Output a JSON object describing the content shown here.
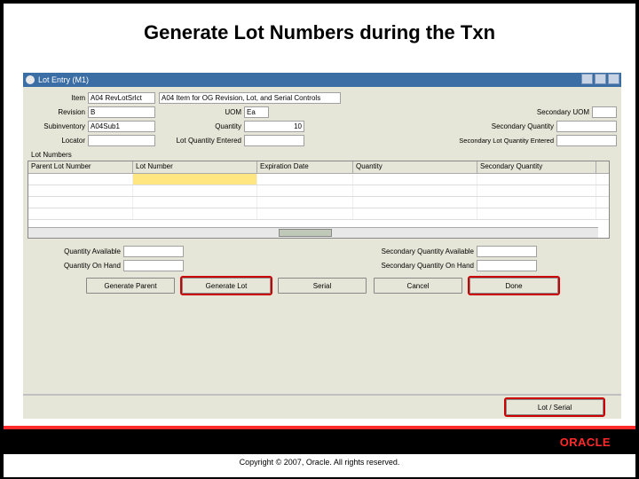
{
  "slide_title": "Generate Lot Numbers during the Txn",
  "window_title": "Lot Entry (M1)",
  "fields": {
    "item_label": "Item",
    "item_value": "A04 RevLotSrlct",
    "item_desc": "A04 Item for OG Revision, Lot, and Serial Controls",
    "revision_label": "Revision",
    "revision_value": "B",
    "uom_label": "UOM",
    "uom_value": "Ea",
    "sec_uom_label": "Secondary UOM",
    "sub_label": "Subinventory",
    "sub_value": "A04Sub1",
    "qty_label": "Quantity",
    "qty_value": "10",
    "sec_qty_label": "Secondary Quantity",
    "locator_label": "Locator",
    "lot_qty_entered_label": "Lot Quantity Entered",
    "sec_lot_qty_entered_label": "Secondary Lot Quantity Entered"
  },
  "section_lot_numbers": "Lot Numbers",
  "grid": {
    "headers": [
      "Parent Lot Number",
      "Lot Number",
      "Expiration Date",
      "Quantity",
      "Secondary Quantity"
    ]
  },
  "qty_block": {
    "qty_avail_label": "Quantity Available",
    "qty_onhand_label": "Quantity On Hand",
    "sec_qty_avail_label": "Secondary Quantity Available",
    "sec_qty_onhand_label": "Secondary Quantity On Hand"
  },
  "buttons": {
    "generate_parent": "Generate Parent",
    "generate_lot": "Generate Lot",
    "serial": "Serial",
    "cancel": "Cancel",
    "done": "Done",
    "lot_serial": "Lot / Serial"
  },
  "brand": {
    "oracle": "ORACLE"
  },
  "copyright": "Copyright © 2007, Oracle. All rights reserved."
}
